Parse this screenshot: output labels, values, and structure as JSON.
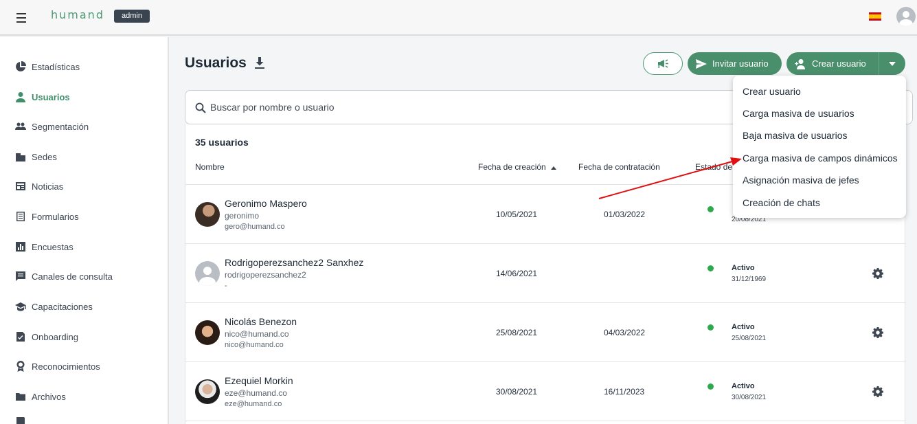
{
  "topbar": {
    "logo": "humand",
    "badge": "admin"
  },
  "sidebar": {
    "items": [
      {
        "label": "Estadísticas",
        "icon": "pie-chart-icon"
      },
      {
        "label": "Usuarios",
        "icon": "person-icon",
        "active": true
      },
      {
        "label": "Segmentación",
        "icon": "group-icon"
      },
      {
        "label": "Sedes",
        "icon": "building-icon"
      },
      {
        "label": "Noticias",
        "icon": "newspaper-icon"
      },
      {
        "label": "Formularios",
        "icon": "form-icon"
      },
      {
        "label": "Encuestas",
        "icon": "bar-chart-icon"
      },
      {
        "label": "Canales de consulta",
        "icon": "chat-icon"
      },
      {
        "label": "Capacitaciones",
        "icon": "school-icon"
      },
      {
        "label": "Onboarding",
        "icon": "checklist-icon"
      },
      {
        "label": "Reconocimientos",
        "icon": "award-icon"
      },
      {
        "label": "Archivos",
        "icon": "folder-icon"
      }
    ]
  },
  "main": {
    "title": "Usuarios",
    "invite_label": "Invitar usuario",
    "create_label": "Crear usuario",
    "search_placeholder": "Buscar por nombre o usuario",
    "count": "35 usuarios",
    "columns": {
      "name": "Nombre",
      "created": "Fecha de creación",
      "hired": "Fecha de contratación",
      "status": "Estado de"
    },
    "rows": [
      {
        "name": "Geronimo Maspero",
        "user": "geronimo",
        "email": "gero@humand.co",
        "created": "10/05/2021",
        "hired": "01/03/2022",
        "status": "",
        "status_date": "20/08/2021",
        "avatar": "photo"
      },
      {
        "name": "Rodrigoperezsanchez2 Sanxhez",
        "user": "rodrigoperezsanchez2",
        "email": "-",
        "created": "14/06/2021",
        "hired": "",
        "status": "Activo",
        "status_date": "31/12/1969",
        "avatar": "placeholder"
      },
      {
        "name": "Nicolás Benezon",
        "user": "nico@humand.co",
        "email": "nico@humand.co",
        "created": "25/08/2021",
        "hired": "04/03/2022",
        "status": "Activo",
        "status_date": "25/08/2021",
        "avatar": "photo"
      },
      {
        "name": "Ezequiel Morkin",
        "user": "eze@humand.co",
        "email": "eze@humand.co",
        "created": "30/08/2021",
        "hired": "16/11/2023",
        "status": "Activo",
        "status_date": "30/08/2021",
        "avatar": "photo"
      }
    ]
  },
  "dropdown": {
    "items": [
      "Crear usuario",
      "Carga masiva de usuarios",
      "Baja masiva de usuarios",
      "Carga masiva de campos dinámicos",
      "Asignación masiva de jefes",
      "Creación de chats"
    ]
  },
  "colors": {
    "brand": "#4a8f6c",
    "active": "#3f8f6a",
    "status_dot": "#2eaa4e",
    "annotation_arrow": "#e01010"
  }
}
